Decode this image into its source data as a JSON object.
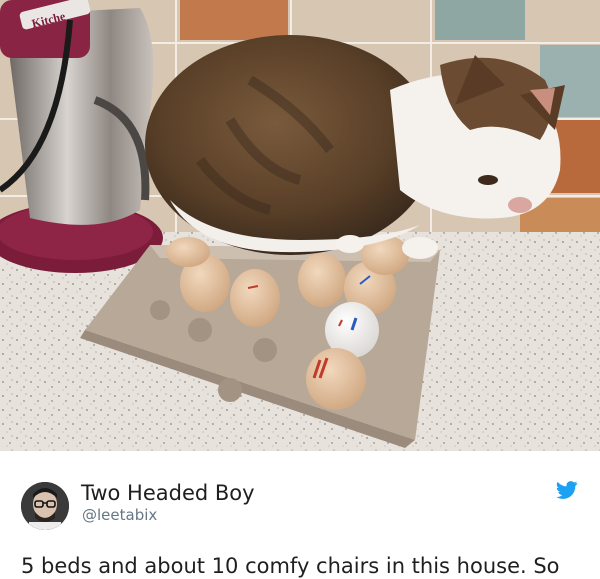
{
  "photo": {
    "subject": "cat-sitting-on-egg-tray"
  },
  "tweet": {
    "display_name": "Two Headed Boy",
    "handle": "@leetabix",
    "text": "5 beds and about 10 comfy chairs in this house. So",
    "brand_icon": "twitter-bird-icon",
    "brand_color": "#1da1f2"
  },
  "photo_text": {
    "mixer_badge": "Kitche"
  }
}
